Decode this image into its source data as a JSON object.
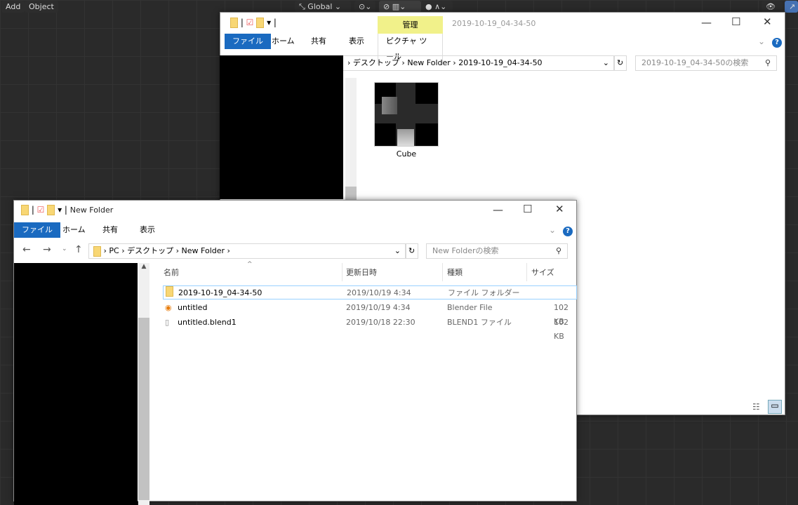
{
  "blender": {
    "menu": [
      "Add",
      "Object"
    ],
    "orientation": "Global"
  },
  "back_window": {
    "title": "2019-10-19_04-34-50",
    "manage_tab": "管理",
    "tabs": [
      "ファイル",
      "ホーム",
      "共有",
      "表示"
    ],
    "picture_tools": "ピクチャ ツール",
    "breadcrumb": [
      "デスクトップ",
      "New Folder",
      "2019-10-19_04-34-50"
    ],
    "search_placeholder": "2019-10-19_04-34-50の検索",
    "items": [
      {
        "name": "Cube"
      }
    ]
  },
  "front_window": {
    "title": "New Folder",
    "tabs": [
      "ファイル",
      "ホーム",
      "共有",
      "表示"
    ],
    "breadcrumb": [
      "PC",
      "デスクトップ",
      "New Folder"
    ],
    "search_placeholder": "New Folderの検索",
    "columns": [
      "名前",
      "更新日時",
      "種類",
      "サイズ"
    ],
    "rows": [
      {
        "name": "2019-10-19_04-34-50",
        "date": "2019/10/19 4:34",
        "type": "ファイル フォルダー",
        "size": "",
        "icon": "folder-icon"
      },
      {
        "name": "untitled",
        "date": "2019/10/19 4:34",
        "type": "Blender File",
        "size": "102 KB",
        "icon": "blender-icon"
      },
      {
        "name": "untitled.blend1",
        "date": "2019/10/18 22:30",
        "type": "BLEND1 ファイル",
        "size": "102 KB",
        "icon": "file-icon"
      }
    ]
  }
}
